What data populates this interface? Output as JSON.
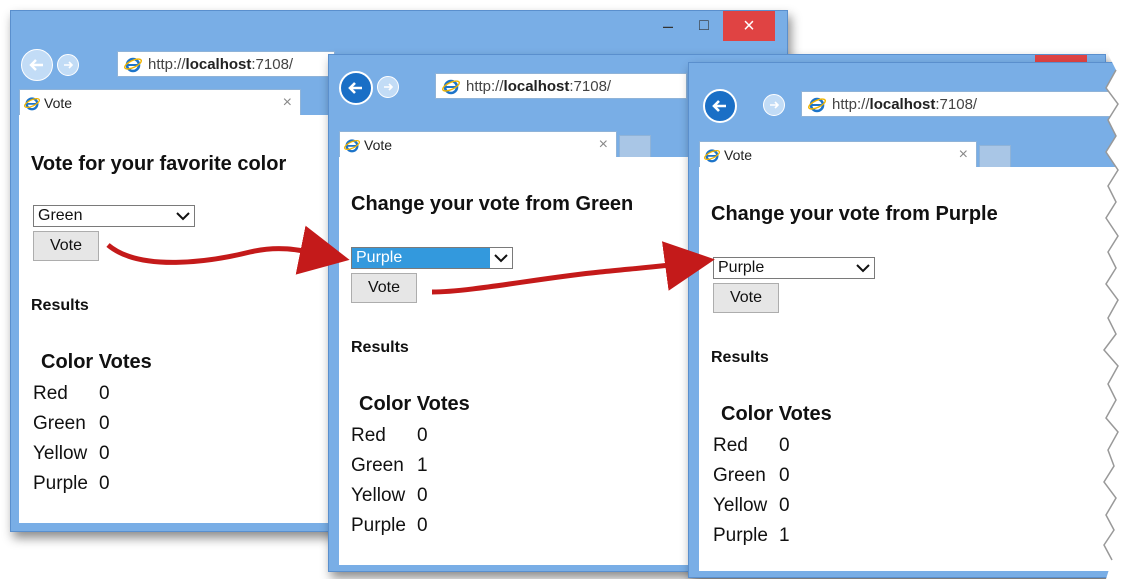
{
  "windows": [
    {
      "url_prefix": "http://",
      "url_host": "localhost",
      "url_port": ":7108/",
      "tab_title": "Vote",
      "tab_close": "×",
      "heading": "Vote for your favorite color",
      "select_value": "Green",
      "vote_label": "Vote",
      "results_label": "Results",
      "table": {
        "headers": [
          "Color",
          "Votes"
        ],
        "rows": [
          {
            "color": "Red",
            "votes": "0"
          },
          {
            "color": "Green",
            "votes": "0"
          },
          {
            "color": "Yellow",
            "votes": "0"
          },
          {
            "color": "Purple",
            "votes": "0"
          }
        ]
      }
    },
    {
      "url_prefix": "http://",
      "url_host": "localhost",
      "url_port": ":7108/",
      "tab_title": "Vote",
      "tab_close": "×",
      "heading": "Change your vote from Green",
      "select_value": "Purple",
      "vote_label": "Vote",
      "results_label": "Results",
      "table": {
        "headers": [
          "Color",
          "Votes"
        ],
        "rows": [
          {
            "color": "Red",
            "votes": "0"
          },
          {
            "color": "Green",
            "votes": "1"
          },
          {
            "color": "Yellow",
            "votes": "0"
          },
          {
            "color": "Purple",
            "votes": "0"
          }
        ]
      }
    },
    {
      "url_prefix": "http://",
      "url_host": "localhost",
      "url_port": ":7108/",
      "tab_title": "Vote",
      "tab_close": "×",
      "heading": "Change your vote from Purple",
      "select_value": "Purple",
      "vote_label": "Vote",
      "results_label": "Results",
      "table": {
        "headers": [
          "Color",
          "Votes"
        ],
        "rows": [
          {
            "color": "Red",
            "votes": "0"
          },
          {
            "color": "Green",
            "votes": "0"
          },
          {
            "color": "Yellow",
            "votes": "0"
          },
          {
            "color": "Purple",
            "votes": "1"
          }
        ]
      }
    }
  ],
  "window_controls": {
    "minimize": "–",
    "maximize": "□",
    "close": "×"
  },
  "colors": {
    "chrome_blue": "#79aee6",
    "close_red": "#e04343",
    "arrow_red": "#c41a1a",
    "selected_blue": "#3399dd"
  }
}
